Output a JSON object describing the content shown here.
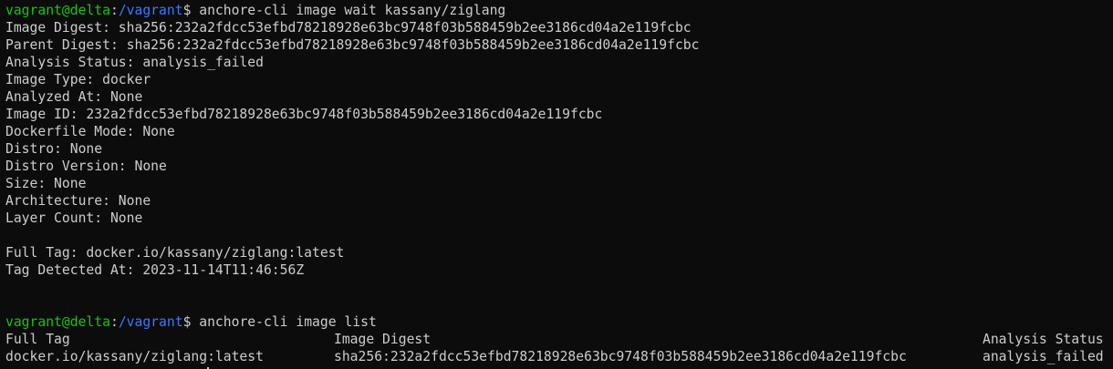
{
  "prompt": {
    "user_host": "vagrant@delta",
    "separator": ":",
    "path": "/vagrant",
    "symbol": "$"
  },
  "commands": {
    "wait": " anchore-cli image wait kassany/ziglang",
    "list": " anchore-cli image list"
  },
  "wait_output": [
    "Image Digest: sha256:232a2fdcc53efbd78218928e63bc9748f03b588459b2ee3186cd04a2e119fcbc",
    "Parent Digest: sha256:232a2fdcc53efbd78218928e63bc9748f03b588459b2ee3186cd04a2e119fcbc",
    "Analysis Status: analysis_failed",
    "Image Type: docker",
    "Analyzed At: None",
    "Image ID: 232a2fdcc53efbd78218928e63bc9748f03b588459b2ee3186cd04a2e119fcbc",
    "Dockerfile Mode: None",
    "Distro: None",
    "Distro Version: None",
    "Size: None",
    "Architecture: None",
    "Layer Count: None",
    "",
    "Full Tag: docker.io/kassany/ziglang:latest",
    "Tag Detected At: 2023-11-14T11:46:56Z"
  ],
  "table": {
    "headers": [
      "Full Tag",
      "Image Digest",
      "Analysis Status"
    ],
    "rows": [
      [
        "docker.io/kassany/ziglang:latest",
        "sha256:232a2fdcc53efbd78218928e63bc9748f03b588459b2ee3186cd04a2e119fcbc",
        "analysis_failed"
      ]
    ]
  },
  "colors": {
    "background": "#0c0c0c",
    "text": "#cccccc",
    "prompt_user": "#16c60c",
    "prompt_path": "#3b78ff"
  }
}
